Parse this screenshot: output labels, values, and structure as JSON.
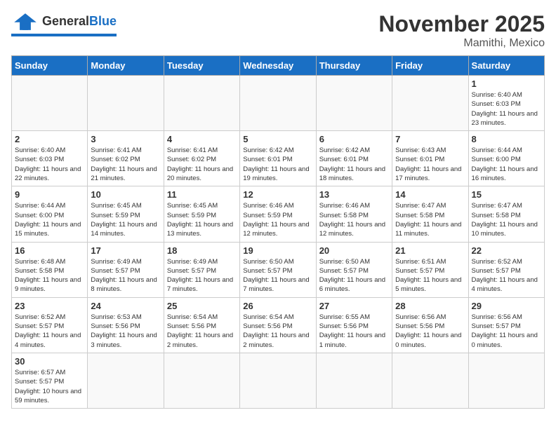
{
  "header": {
    "logo_general": "General",
    "logo_blue": "Blue",
    "month_title": "November 2025",
    "location": "Mamithi, Mexico"
  },
  "weekdays": [
    "Sunday",
    "Monday",
    "Tuesday",
    "Wednesday",
    "Thursday",
    "Friday",
    "Saturday"
  ],
  "days": [
    {
      "num": "",
      "sunrise": "",
      "sunset": "",
      "daylight": "",
      "empty": true
    },
    {
      "num": "",
      "sunrise": "",
      "sunset": "",
      "daylight": "",
      "empty": true
    },
    {
      "num": "",
      "sunrise": "",
      "sunset": "",
      "daylight": "",
      "empty": true
    },
    {
      "num": "",
      "sunrise": "",
      "sunset": "",
      "daylight": "",
      "empty": true
    },
    {
      "num": "",
      "sunrise": "",
      "sunset": "",
      "daylight": "",
      "empty": true
    },
    {
      "num": "",
      "sunrise": "",
      "sunset": "",
      "daylight": "",
      "empty": true
    },
    {
      "num": "1",
      "sunrise": "Sunrise: 6:40 AM",
      "sunset": "Sunset: 6:03 PM",
      "daylight": "Daylight: 11 hours and 23 minutes.",
      "empty": false
    },
    {
      "num": "2",
      "sunrise": "Sunrise: 6:40 AM",
      "sunset": "Sunset: 6:03 PM",
      "daylight": "Daylight: 11 hours and 22 minutes.",
      "empty": false
    },
    {
      "num": "3",
      "sunrise": "Sunrise: 6:41 AM",
      "sunset": "Sunset: 6:02 PM",
      "daylight": "Daylight: 11 hours and 21 minutes.",
      "empty": false
    },
    {
      "num": "4",
      "sunrise": "Sunrise: 6:41 AM",
      "sunset": "Sunset: 6:02 PM",
      "daylight": "Daylight: 11 hours and 20 minutes.",
      "empty": false
    },
    {
      "num": "5",
      "sunrise": "Sunrise: 6:42 AM",
      "sunset": "Sunset: 6:01 PM",
      "daylight": "Daylight: 11 hours and 19 minutes.",
      "empty": false
    },
    {
      "num": "6",
      "sunrise": "Sunrise: 6:42 AM",
      "sunset": "Sunset: 6:01 PM",
      "daylight": "Daylight: 11 hours and 18 minutes.",
      "empty": false
    },
    {
      "num": "7",
      "sunrise": "Sunrise: 6:43 AM",
      "sunset": "Sunset: 6:01 PM",
      "daylight": "Daylight: 11 hours and 17 minutes.",
      "empty": false
    },
    {
      "num": "8",
      "sunrise": "Sunrise: 6:44 AM",
      "sunset": "Sunset: 6:00 PM",
      "daylight": "Daylight: 11 hours and 16 minutes.",
      "empty": false
    },
    {
      "num": "9",
      "sunrise": "Sunrise: 6:44 AM",
      "sunset": "Sunset: 6:00 PM",
      "daylight": "Daylight: 11 hours and 15 minutes.",
      "empty": false
    },
    {
      "num": "10",
      "sunrise": "Sunrise: 6:45 AM",
      "sunset": "Sunset: 5:59 PM",
      "daylight": "Daylight: 11 hours and 14 minutes.",
      "empty": false
    },
    {
      "num": "11",
      "sunrise": "Sunrise: 6:45 AM",
      "sunset": "Sunset: 5:59 PM",
      "daylight": "Daylight: 11 hours and 13 minutes.",
      "empty": false
    },
    {
      "num": "12",
      "sunrise": "Sunrise: 6:46 AM",
      "sunset": "Sunset: 5:59 PM",
      "daylight": "Daylight: 11 hours and 12 minutes.",
      "empty": false
    },
    {
      "num": "13",
      "sunrise": "Sunrise: 6:46 AM",
      "sunset": "Sunset: 5:58 PM",
      "daylight": "Daylight: 11 hours and 12 minutes.",
      "empty": false
    },
    {
      "num": "14",
      "sunrise": "Sunrise: 6:47 AM",
      "sunset": "Sunset: 5:58 PM",
      "daylight": "Daylight: 11 hours and 11 minutes.",
      "empty": false
    },
    {
      "num": "15",
      "sunrise": "Sunrise: 6:47 AM",
      "sunset": "Sunset: 5:58 PM",
      "daylight": "Daylight: 11 hours and 10 minutes.",
      "empty": false
    },
    {
      "num": "16",
      "sunrise": "Sunrise: 6:48 AM",
      "sunset": "Sunset: 5:58 PM",
      "daylight": "Daylight: 11 hours and 9 minutes.",
      "empty": false
    },
    {
      "num": "17",
      "sunrise": "Sunrise: 6:49 AM",
      "sunset": "Sunset: 5:57 PM",
      "daylight": "Daylight: 11 hours and 8 minutes.",
      "empty": false
    },
    {
      "num": "18",
      "sunrise": "Sunrise: 6:49 AM",
      "sunset": "Sunset: 5:57 PM",
      "daylight": "Daylight: 11 hours and 7 minutes.",
      "empty": false
    },
    {
      "num": "19",
      "sunrise": "Sunrise: 6:50 AM",
      "sunset": "Sunset: 5:57 PM",
      "daylight": "Daylight: 11 hours and 7 minutes.",
      "empty": false
    },
    {
      "num": "20",
      "sunrise": "Sunrise: 6:50 AM",
      "sunset": "Sunset: 5:57 PM",
      "daylight": "Daylight: 11 hours and 6 minutes.",
      "empty": false
    },
    {
      "num": "21",
      "sunrise": "Sunrise: 6:51 AM",
      "sunset": "Sunset: 5:57 PM",
      "daylight": "Daylight: 11 hours and 5 minutes.",
      "empty": false
    },
    {
      "num": "22",
      "sunrise": "Sunrise: 6:52 AM",
      "sunset": "Sunset: 5:57 PM",
      "daylight": "Daylight: 11 hours and 4 minutes.",
      "empty": false
    },
    {
      "num": "23",
      "sunrise": "Sunrise: 6:52 AM",
      "sunset": "Sunset: 5:57 PM",
      "daylight": "Daylight: 11 hours and 4 minutes.",
      "empty": false
    },
    {
      "num": "24",
      "sunrise": "Sunrise: 6:53 AM",
      "sunset": "Sunset: 5:56 PM",
      "daylight": "Daylight: 11 hours and 3 minutes.",
      "empty": false
    },
    {
      "num": "25",
      "sunrise": "Sunrise: 6:54 AM",
      "sunset": "Sunset: 5:56 PM",
      "daylight": "Daylight: 11 hours and 2 minutes.",
      "empty": false
    },
    {
      "num": "26",
      "sunrise": "Sunrise: 6:54 AM",
      "sunset": "Sunset: 5:56 PM",
      "daylight": "Daylight: 11 hours and 2 minutes.",
      "empty": false
    },
    {
      "num": "27",
      "sunrise": "Sunrise: 6:55 AM",
      "sunset": "Sunset: 5:56 PM",
      "daylight": "Daylight: 11 hours and 1 minute.",
      "empty": false
    },
    {
      "num": "28",
      "sunrise": "Sunrise: 6:56 AM",
      "sunset": "Sunset: 5:56 PM",
      "daylight": "Daylight: 11 hours and 0 minutes.",
      "empty": false
    },
    {
      "num": "29",
      "sunrise": "Sunrise: 6:56 AM",
      "sunset": "Sunset: 5:57 PM",
      "daylight": "Daylight: 11 hours and 0 minutes.",
      "empty": false
    },
    {
      "num": "30",
      "sunrise": "Sunrise: 6:57 AM",
      "sunset": "Sunset: 5:57 PM",
      "daylight": "Daylight: 10 hours and 59 minutes.",
      "empty": false
    },
    {
      "num": "",
      "sunrise": "",
      "sunset": "",
      "daylight": "",
      "empty": true
    },
    {
      "num": "",
      "sunrise": "",
      "sunset": "",
      "daylight": "",
      "empty": true
    },
    {
      "num": "",
      "sunrise": "",
      "sunset": "",
      "daylight": "",
      "empty": true
    },
    {
      "num": "",
      "sunrise": "",
      "sunset": "",
      "daylight": "",
      "empty": true
    },
    {
      "num": "",
      "sunrise": "",
      "sunset": "",
      "daylight": "",
      "empty": true
    },
    {
      "num": "",
      "sunrise": "",
      "sunset": "",
      "daylight": "",
      "empty": true
    }
  ]
}
